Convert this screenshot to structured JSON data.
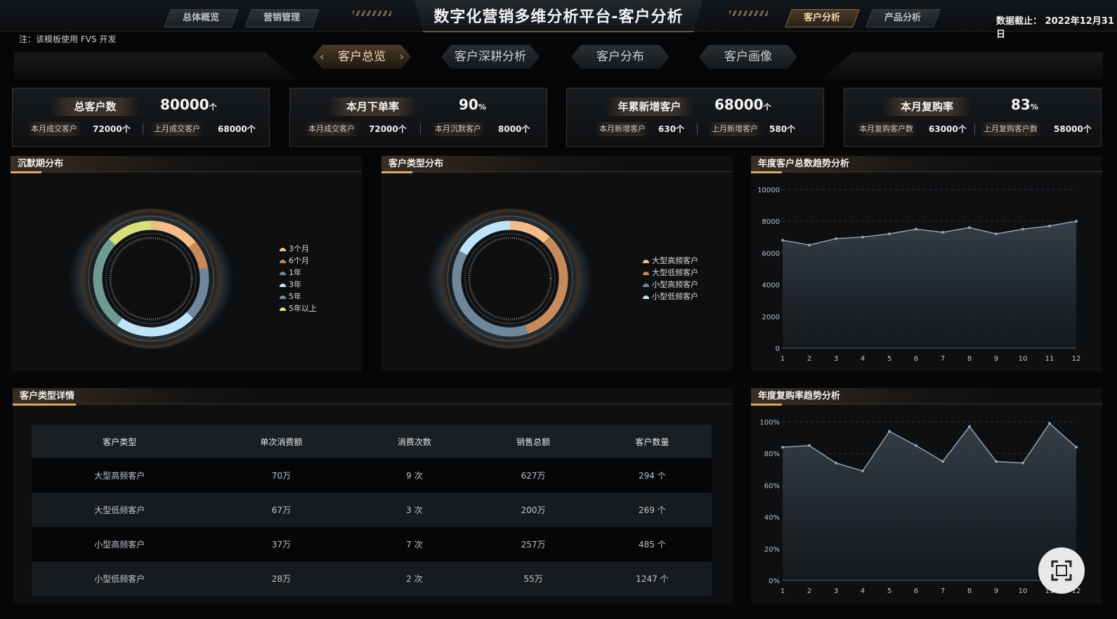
{
  "header": {
    "title": "数字化营销多维分析平台-客户分析",
    "date_label": "数据截止： 2022年12月31日",
    "nav_left": [
      "总体概览",
      "营销管理"
    ],
    "nav_right": [
      "客户分析",
      "产品分析"
    ],
    "active_nav": "客户分析"
  },
  "note": "注：该模板使用 FVS 开发",
  "subnav": {
    "tabs": [
      "客户总览",
      "客户深耕分析",
      "客户分布",
      "客户画像"
    ],
    "active": "客户总览"
  },
  "kpis": [
    {
      "label": "总客户数",
      "value": "80000",
      "unit": "个",
      "sub1_label": "本月成交客户",
      "sub1_value": "72000个",
      "sub2_label": "上月成交客户",
      "sub2_value": "68000个"
    },
    {
      "label": "本月下单率",
      "value": "90",
      "unit": "%",
      "sub1_label": "本月成交客户",
      "sub1_value": "72000个",
      "sub2_label": "本月沉默客户",
      "sub2_value": "8000个"
    },
    {
      "label": "年累新增客户",
      "value": "68000",
      "unit": "个",
      "sub1_label": "本月新增客户",
      "sub1_value": "630个",
      "sub2_label": "上月新增客户",
      "sub2_value": "580个"
    },
    {
      "label": "本月复购率",
      "value": "83",
      "unit": "%",
      "sub1_label": "本月复购客户数",
      "sub1_value": "63000个",
      "sub2_label": "上月复购客户数",
      "sub2_value": "58000个"
    }
  ],
  "panels": {
    "silent": "沉默期分布",
    "type_dist": "客户类型分布",
    "trend_total": "年度客户总数趋势分析",
    "type_detail": "客户类型详情",
    "trend_repurchase": "年度复购率趋势分析"
  },
  "colors": {
    "accent": "#d9a86a",
    "peach": "#f2bd8a",
    "bronze": "#c88a5a",
    "slate": "#6e879a",
    "ice": "#bfe3f8",
    "teal": "#6e9a94",
    "lime": "#d8e07a"
  },
  "chart_data": [
    {
      "type": "pie",
      "title": "沉默期分布",
      "categories": [
        "3个月",
        "6个月",
        "1年",
        "3年",
        "5年",
        "5年以上"
      ],
      "values": [
        14,
        8,
        15,
        23,
        27,
        13
      ],
      "colors": [
        "#f2bd8a",
        "#c88a5a",
        "#6e879a",
        "#bfe3f8",
        "#6e9a94",
        "#d8e07a"
      ]
    },
    {
      "type": "pie",
      "title": "客户类型分布",
      "categories": [
        "大型高频客户",
        "大型低频客户",
        "小型高频客户",
        "小型低频客户"
      ],
      "values": [
        12,
        33,
        38,
        17
      ],
      "colors": [
        "#f2bd8a",
        "#c88a5a",
        "#6e879a",
        "#bfe3f8"
      ]
    },
    {
      "type": "area",
      "title": "年度客户总数趋势分析",
      "x": [
        1,
        2,
        3,
        4,
        5,
        6,
        7,
        8,
        9,
        10,
        11,
        12
      ],
      "values": [
        6800,
        6500,
        6900,
        7000,
        7200,
        7500,
        7300,
        7600,
        7200,
        7500,
        7700,
        8000
      ],
      "ylim": [
        0,
        10000
      ],
      "yticks": [
        0,
        2000,
        4000,
        6000,
        8000,
        10000
      ],
      "grid": true
    },
    {
      "type": "area",
      "title": "年度复购率趋势分析",
      "x": [
        1,
        2,
        3,
        4,
        5,
        6,
        7,
        8,
        9,
        10,
        11,
        12
      ],
      "values": [
        84,
        85,
        74,
        69,
        94,
        85,
        75,
        97,
        75,
        74,
        99,
        84
      ],
      "ylim": [
        0,
        100
      ],
      "yticks": [
        "0%",
        "20%",
        "40%",
        "60%",
        "80%",
        "100%"
      ],
      "grid": true
    }
  ],
  "table": {
    "headers": [
      "客户类型",
      "单次消费额",
      "消费次数",
      "销售总额",
      "客户数量"
    ],
    "rows": [
      [
        "大型高频客户",
        "70万",
        "9 次",
        "627万",
        "294 个"
      ],
      [
        "大型低频客户",
        "67万",
        "3 次",
        "200万",
        "269 个"
      ],
      [
        "小型高频客户",
        "37万",
        "7 次",
        "257万",
        "485 个"
      ],
      [
        "小型低频客户",
        "28万",
        "2 次",
        "55万",
        "1247 个"
      ]
    ]
  }
}
